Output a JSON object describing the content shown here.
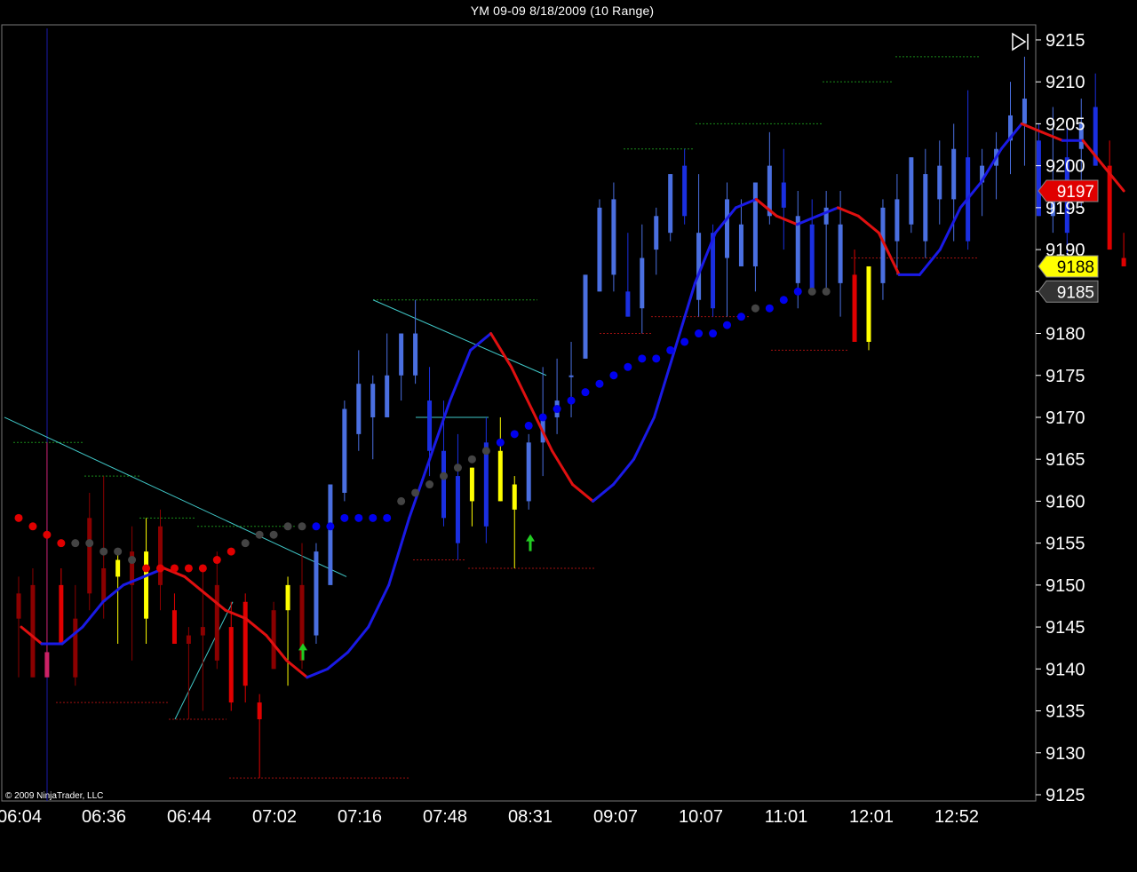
{
  "window": {
    "title": "YM 09-09  8/18/2009 (10 Range)"
  },
  "copyright": "© 2009 NinjaTrader, LLC",
  "colors": {
    "background": "#000000",
    "up_candle": "#4a6fe0",
    "up_candle_bright": "#1a2fe0",
    "down_candle": "#8b0000",
    "down_candle_bright": "#e00000",
    "neutral_candle": "#ffff00",
    "ma_up": "#1a1ae6",
    "ma_down": "#e01010",
    "dots_up": "#0000ee",
    "dots_down": "#e00000",
    "dots_neutral": "#444444",
    "trendline": "#40c8c8",
    "resistance": "#1a8a1a",
    "support": "#a01010",
    "arrow": "#22cc22"
  },
  "chart_data": {
    "type": "candlestick",
    "title": "YM 09-09  8/18/2009 (10 Range)",
    "instrument": "YM 09-09",
    "date": "8/18/2009",
    "bar_type": "10 Range",
    "ylim": [
      9124,
      9217
    ],
    "y_ticks": [
      9125,
      9130,
      9135,
      9140,
      9145,
      9150,
      9155,
      9160,
      9165,
      9170,
      9175,
      9180,
      9185,
      9190,
      9195,
      9200,
      9205,
      9210,
      9215
    ],
    "x_tick_labels": [
      "06:04",
      "06:36",
      "06:44",
      "07:02",
      "07:16",
      "07:48",
      "08:31",
      "09:07",
      "10:07",
      "11:01",
      "12:01",
      "12:52"
    ],
    "price_markers": [
      {
        "label": "9197",
        "value": 9197,
        "color": "#e00000",
        "text_color": "#ffffff"
      },
      {
        "label": "9188",
        "value": 9188,
        "color": "#ffff00",
        "text_color": "#000000"
      },
      {
        "label": "9185",
        "value": 9185,
        "color": "#333333",
        "text_color": "#ffffff"
      }
    ],
    "candles": [
      {
        "o": 9149,
        "h": 9151,
        "l": 9139,
        "c": 9146,
        "color": "dr"
      },
      {
        "o": 9150,
        "h": 9152,
        "l": 9139,
        "c": 9139,
        "color": "dr"
      },
      {
        "o": 9142,
        "h": 9167,
        "l": 9139,
        "c": 9139,
        "color": "pk"
      },
      {
        "o": 9150,
        "h": 9152,
        "l": 9143,
        "c": 9143,
        "color": "r"
      },
      {
        "o": 9146,
        "h": 9150,
        "l": 9138,
        "c": 9139,
        "color": "dr"
      },
      {
        "o": 9149,
        "h": 9161,
        "l": 9147,
        "c": 9158,
        "color": "dr"
      },
      {
        "o": 9152,
        "h": 9163,
        "l": 9146,
        "c": 9148,
        "color": "dr"
      },
      {
        "o": 9153,
        "h": 9154,
        "l": 9143,
        "c": 9151,
        "color": "y"
      },
      {
        "o": 9150,
        "h": 9157,
        "l": 9141,
        "c": 9154,
        "color": "dr"
      },
      {
        "o": 9154,
        "h": 9158,
        "l": 9143,
        "c": 9146,
        "color": "y"
      },
      {
        "o": 9157,
        "h": 9159,
        "l": 9147,
        "c": 9150,
        "color": "dr"
      },
      {
        "o": 9147,
        "h": 9149,
        "l": 9143,
        "c": 9143,
        "color": "r"
      },
      {
        "o": 9144,
        "h": 9145,
        "l": 9134,
        "c": 9143,
        "color": "dr"
      },
      {
        "o": 9145,
        "h": 9152,
        "l": 9135,
        "c": 9144,
        "color": "dr"
      },
      {
        "o": 9150,
        "h": 9154,
        "l": 9140,
        "c": 9141,
        "color": "dr"
      },
      {
        "o": 9145,
        "h": 9148,
        "l": 9135,
        "c": 9136,
        "color": "r"
      },
      {
        "o": 9148,
        "h": 9149,
        "l": 9136,
        "c": 9138,
        "color": "r"
      },
      {
        "o": 9136,
        "h": 9137,
        "l": 9127,
        "c": 9134,
        "color": "r"
      },
      {
        "o": 9147,
        "h": 9148,
        "l": 9140,
        "c": 9140,
        "color": "dr"
      },
      {
        "o": 9150,
        "h": 9151,
        "l": 9138,
        "c": 9147,
        "color": "y"
      },
      {
        "o": 9150,
        "h": 9155,
        "l": 9140,
        "c": 9141,
        "color": "dr"
      },
      {
        "o": 9144,
        "h": 9155,
        "l": 9143,
        "c": 9154,
        "color": "b"
      },
      {
        "o": 9150,
        "h": 9162,
        "l": 9150,
        "c": 9162,
        "color": "b"
      },
      {
        "o": 9161,
        "h": 9172,
        "l": 9160,
        "c": 9171,
        "color": "b"
      },
      {
        "o": 9168,
        "h": 9178,
        "l": 9166,
        "c": 9174,
        "color": "b"
      },
      {
        "o": 9170,
        "h": 9175,
        "l": 9165,
        "c": 9174,
        "color": "b"
      },
      {
        "o": 9170,
        "h": 9180,
        "l": 9170,
        "c": 9175,
        "color": "b"
      },
      {
        "o": 9175,
        "h": 9180,
        "l": 9172,
        "c": 9180,
        "color": "b"
      },
      {
        "o": 9175,
        "h": 9184,
        "l": 9174,
        "c": 9180,
        "color": "b"
      },
      {
        "o": 9172,
        "h": 9176,
        "l": 9163,
        "c": 9166,
        "color": "bb"
      },
      {
        "o": 9166,
        "h": 9172,
        "l": 9157,
        "c": 9158,
        "color": "bb"
      },
      {
        "o": 9163,
        "h": 9168,
        "l": 9153,
        "c": 9155,
        "color": "bb"
      },
      {
        "o": 9160,
        "h": 9164,
        "l": 9157,
        "c": 9164,
        "color": "y"
      },
      {
        "o": 9167,
        "h": 9170,
        "l": 9155,
        "c": 9157,
        "color": "bb"
      },
      {
        "o": 9166,
        "h": 9170,
        "l": 9160,
        "c": 9160,
        "color": "y"
      },
      {
        "o": 9162,
        "h": 9163,
        "l": 9152,
        "c": 9159,
        "color": "y"
      },
      {
        "o": 9160,
        "h": 9168,
        "l": 9159,
        "c": 9167,
        "color": "b"
      },
      {
        "o": 9167,
        "h": 9176,
        "l": 9163,
        "c": 9170,
        "color": "b"
      },
      {
        "o": 9170,
        "h": 9177,
        "l": 9168,
        "c": 9172,
        "color": "b"
      },
      {
        "o": 9175,
        "h": 9179,
        "l": 9170,
        "c": 9175,
        "color": "b"
      },
      {
        "o": 9177,
        "h": 9187,
        "l": 9177,
        "c": 9187,
        "color": "b"
      },
      {
        "o": 9185,
        "h": 9196,
        "l": 9185,
        "c": 9195,
        "color": "b"
      },
      {
        "o": 9187,
        "h": 9198,
        "l": 9185,
        "c": 9196,
        "color": "b"
      },
      {
        "o": 9185,
        "h": 9192,
        "l": 9182,
        "c": 9182,
        "color": "bb"
      },
      {
        "o": 9189,
        "h": 9193,
        "l": 9180,
        "c": 9183,
        "color": "b"
      },
      {
        "o": 9190,
        "h": 9195,
        "l": 9187,
        "c": 9194,
        "color": "b"
      },
      {
        "o": 9192,
        "h": 9199,
        "l": 9191,
        "c": 9199,
        "color": "b"
      },
      {
        "o": 9200,
        "h": 9202,
        "l": 9193,
        "c": 9194,
        "color": "bb"
      },
      {
        "o": 9192,
        "h": 9199,
        "l": 9182,
        "c": 9184,
        "color": "b"
      },
      {
        "o": 9192,
        "h": 9193,
        "l": 9182,
        "c": 9183,
        "color": "bb"
      },
      {
        "o": 9189,
        "h": 9198,
        "l": 9182,
        "c": 9196,
        "color": "b"
      },
      {
        "o": 9193,
        "h": 9196,
        "l": 9188,
        "c": 9188,
        "color": "b"
      },
      {
        "o": 9188,
        "h": 9198,
        "l": 9185,
        "c": 9198,
        "color": "b"
      },
      {
        "o": 9194,
        "h": 9204,
        "l": 9193,
        "c": 9200,
        "color": "b"
      },
      {
        "o": 9198,
        "h": 9202,
        "l": 9190,
        "c": 9195,
        "color": "bb"
      },
      {
        "o": 9186,
        "h": 9197,
        "l": 9183,
        "c": 9194,
        "color": "b"
      },
      {
        "o": 9193,
        "h": 9196,
        "l": 9185,
        "c": 9185,
        "color": "bb"
      },
      {
        "o": 9193,
        "h": 9197,
        "l": 9185,
        "c": 9195,
        "color": "b"
      },
      {
        "o": 9186,
        "h": 9197,
        "l": 9182,
        "c": 9193,
        "color": "b"
      },
      {
        "o": 9187,
        "h": 9190,
        "l": 9179,
        "c": 9179,
        "color": "r"
      },
      {
        "o": 9179,
        "h": 9188,
        "l": 9178,
        "c": 9188,
        "color": "y"
      },
      {
        "o": 9186,
        "h": 9196,
        "l": 9184,
        "c": 9195,
        "color": "b"
      },
      {
        "o": 9191,
        "h": 9199,
        "l": 9187,
        "c": 9196,
        "color": "b"
      },
      {
        "o": 9193,
        "h": 9201,
        "l": 9192,
        "c": 9201,
        "color": "b"
      },
      {
        "o": 9191,
        "h": 9202,
        "l": 9189,
        "c": 9199,
        "color": "b"
      },
      {
        "o": 9196,
        "h": 9203,
        "l": 9193,
        "c": 9200,
        "color": "b"
      },
      {
        "o": 9196,
        "h": 9205,
        "l": 9191,
        "c": 9202,
        "color": "b"
      },
      {
        "o": 9201,
        "h": 9209,
        "l": 9190,
        "c": 9191,
        "color": "bb"
      },
      {
        "o": 9198,
        "h": 9202,
        "l": 9194,
        "c": 9200,
        "color": "b"
      },
      {
        "o": 9200,
        "h": 9204,
        "l": 9196,
        "c": 9202,
        "color": "b"
      },
      {
        "o": 9203,
        "h": 9210,
        "l": 9199,
        "c": 9206,
        "color": "b"
      },
      {
        "o": 9205,
        "h": 9213,
        "l": 9200,
        "c": 9208,
        "color": "b"
      },
      {
        "o": 9203,
        "h": 9205,
        "l": 9194,
        "c": 9194,
        "color": "bb"
      },
      {
        "o": 9198,
        "h": 9207,
        "l": 9192,
        "c": 9194,
        "color": "b"
      },
      {
        "o": 9201,
        "h": 9205,
        "l": 9189,
        "c": 9192,
        "color": "bb"
      },
      {
        "o": 9202,
        "h": 9208,
        "l": 9195,
        "c": 9205,
        "color": "b"
      },
      {
        "o": 9200,
        "h": 9211,
        "l": 9200,
        "c": 9207,
        "color": "bb"
      },
      {
        "o": 9200,
        "h": 9203,
        "l": 9190,
        "c": 9190,
        "color": "r"
      },
      {
        "o": 9189,
        "h": 9192,
        "l": 9188,
        "c": 9188,
        "color": "r"
      }
    ],
    "moving_average": [
      9145,
      9143,
      9143,
      9145,
      9148,
      9150,
      9151,
      9152,
      9151,
      9149,
      9147,
      9146,
      9144,
      9141,
      9139,
      9140,
      9142,
      9145,
      9150,
      9158,
      9165,
      9172,
      9178,
      9180,
      9176,
      9171,
      9166,
      9162,
      9160,
      9162,
      9165,
      9170,
      9178,
      9186,
      9192,
      9195,
      9196,
      9194,
      9193,
      9194,
      9195,
      9194,
      9192,
      9187,
      9187,
      9190,
      9195,
      9198,
      9202,
      9205,
      9204,
      9203,
      9203,
      9200,
      9197
    ],
    "stop_dots": [
      9158,
      9157,
      9156,
      9155,
      9155,
      9155,
      9154,
      9154,
      9153,
      9152,
      9152,
      9152,
      9152,
      9152,
      9153,
      9154,
      9155,
      9156,
      9156,
      9157,
      9157,
      9157,
      9157,
      9158,
      9158,
      9158,
      9158,
      9160,
      9161,
      9162,
      9163,
      9164,
      9165,
      9166,
      9167,
      9168,
      9169,
      9170,
      9171,
      9172,
      9173,
      9174,
      9175,
      9176,
      9177,
      9177,
      9178,
      9179,
      9180,
      9180,
      9181,
      9182,
      9183,
      9183,
      9184,
      9185,
      9185,
      9185
    ]
  }
}
